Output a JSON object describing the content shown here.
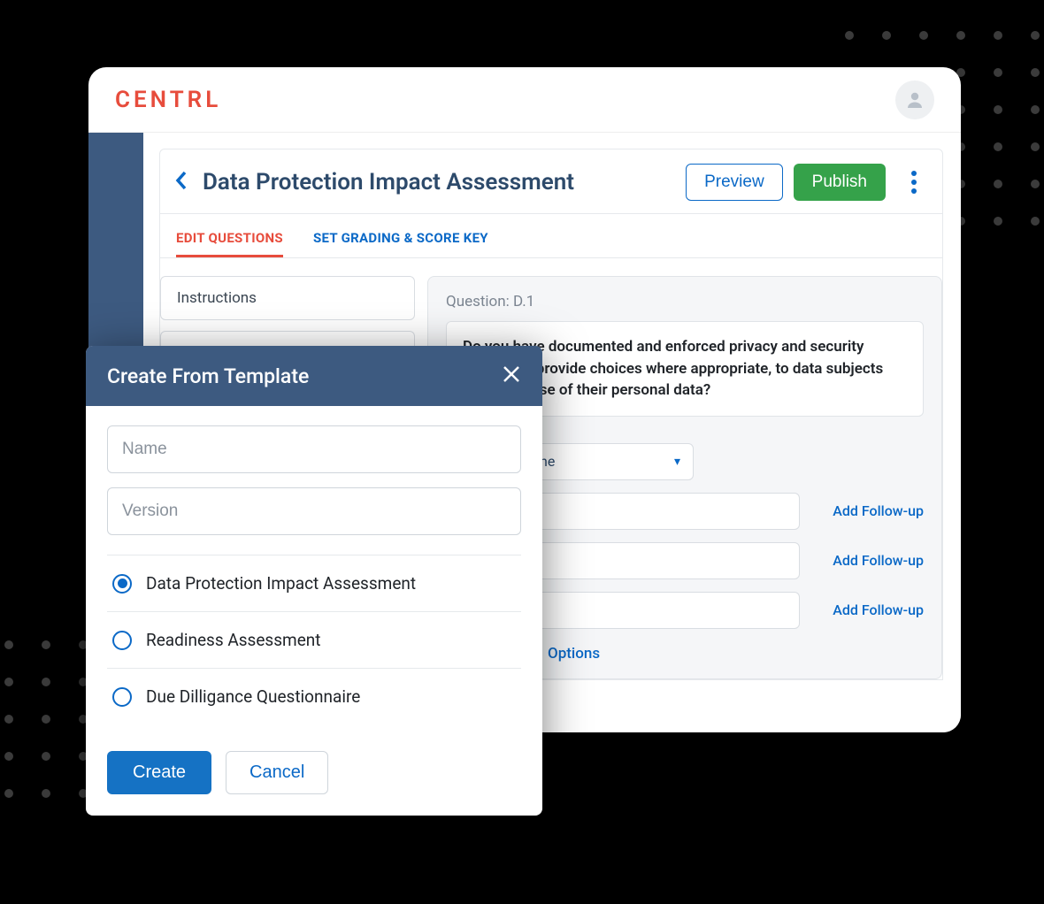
{
  "brand": "CENTRL",
  "page": {
    "title": "Data Protection Impact Assessment",
    "preview_label": "Preview",
    "publish_label": "Publish"
  },
  "tabs": {
    "edit": "EDIT QUESTIONS",
    "grading": "SET GRADING & SCORE KEY"
  },
  "left": {
    "instructions": "Instructions"
  },
  "question": {
    "label": "Question: D.1",
    "text": "Do you have documented and enforced privacy and security policies to provide choices where appropriate, to data subjects regarding use of their personal data?",
    "select_value": "One",
    "followup": "Add Follow-up",
    "options": "Options"
  },
  "modal": {
    "title": "Create From Template",
    "name_placeholder": "Name",
    "version_placeholder": "Version",
    "templates": [
      {
        "label": "Data Protection Impact Assessment",
        "selected": true
      },
      {
        "label": "Readiness Assessment",
        "selected": false
      },
      {
        "label": "Due Dilligance Questionnaire",
        "selected": false
      }
    ],
    "create": "Create",
    "cancel": "Cancel"
  }
}
